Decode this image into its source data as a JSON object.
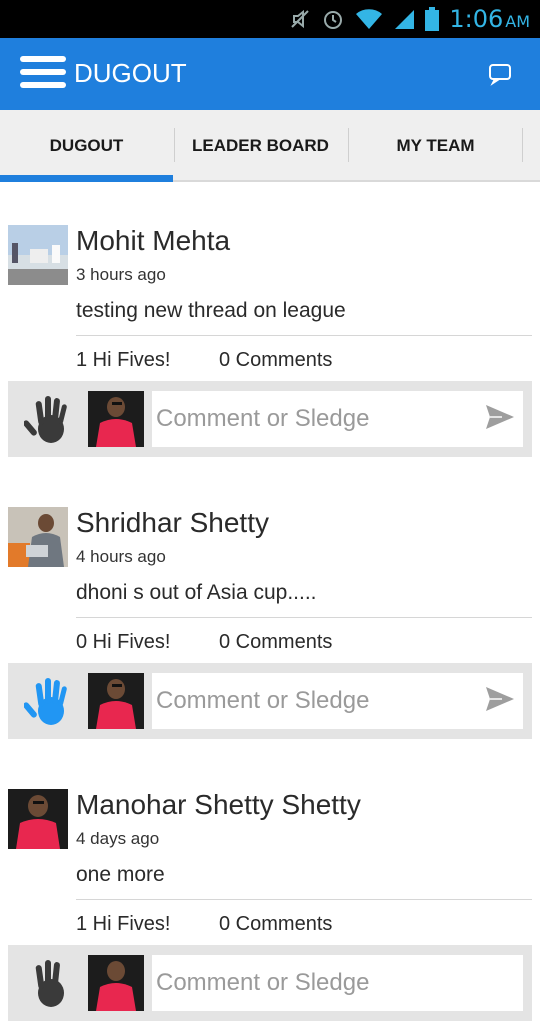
{
  "status_bar": {
    "time": "1:06",
    "ampm": "AM"
  },
  "app_bar": {
    "title": "DUGOUT"
  },
  "tabs": [
    {
      "label": "DUGOUT",
      "active": true
    },
    {
      "label": "LEADER BOARD",
      "active": false
    },
    {
      "label": "MY TEAM",
      "active": false
    }
  ],
  "posts": [
    {
      "author": "Mohit Mehta",
      "time_ago": "3 hours ago",
      "message": "testing new thread on league",
      "hi_fives": "1 Hi Fives!",
      "comments": "0 Comments",
      "hi_five_state": "given"
    },
    {
      "author": "Shridhar Shetty",
      "time_ago": "4 hours ago",
      "message": "dhoni s out of Asia cup.....",
      "hi_fives": "0 Hi Fives!",
      "comments": "0 Comments",
      "hi_five_state": "available"
    },
    {
      "author": "Manohar Shetty Shetty",
      "time_ago": "4 days ago",
      "message": "one more",
      "hi_fives": "1 Hi Fives!",
      "comments": "0 Comments",
      "hi_five_state": "given"
    }
  ],
  "comment_placeholder": "Comment or Sledge",
  "colors": {
    "primary": "#1f7fdd",
    "status_icon": "#33b5e5",
    "hand_given": "#3a3a3a",
    "hand_available": "#2196f3"
  },
  "icons": {
    "menu": "hamburger-icon",
    "chat": "chat-bubble-icon",
    "send": "send-icon",
    "hand": "hand-print-icon"
  }
}
